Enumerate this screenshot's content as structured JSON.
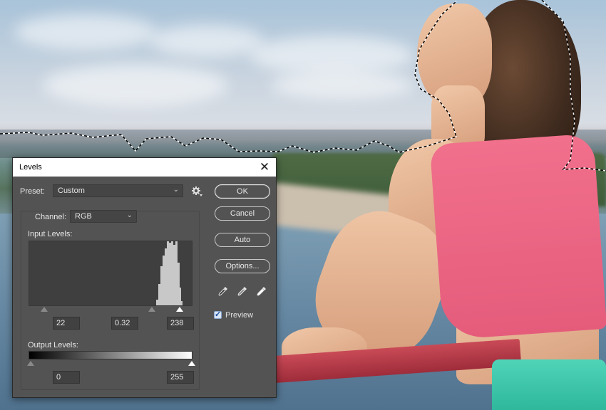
{
  "dialog": {
    "title": "Levels",
    "close_icon": "close-icon",
    "preset": {
      "label": "Preset:",
      "value": "Custom"
    },
    "channel": {
      "label": "Channel:",
      "value": "RGB"
    },
    "input_levels": {
      "label": "Input Levels:",
      "black": "22",
      "gamma": "0.32",
      "white": "238"
    },
    "output_levels": {
      "label": "Output Levels:",
      "black": "0",
      "white": "255"
    },
    "buttons": {
      "ok": "OK",
      "cancel": "Cancel",
      "auto": "Auto",
      "options": "Options..."
    },
    "preview": {
      "label": "Preview",
      "checked": true
    },
    "icons": [
      "gear-icon",
      "black-eyedropper-icon",
      "gray-eyedropper-icon",
      "white-eyedropper-icon"
    ]
  }
}
